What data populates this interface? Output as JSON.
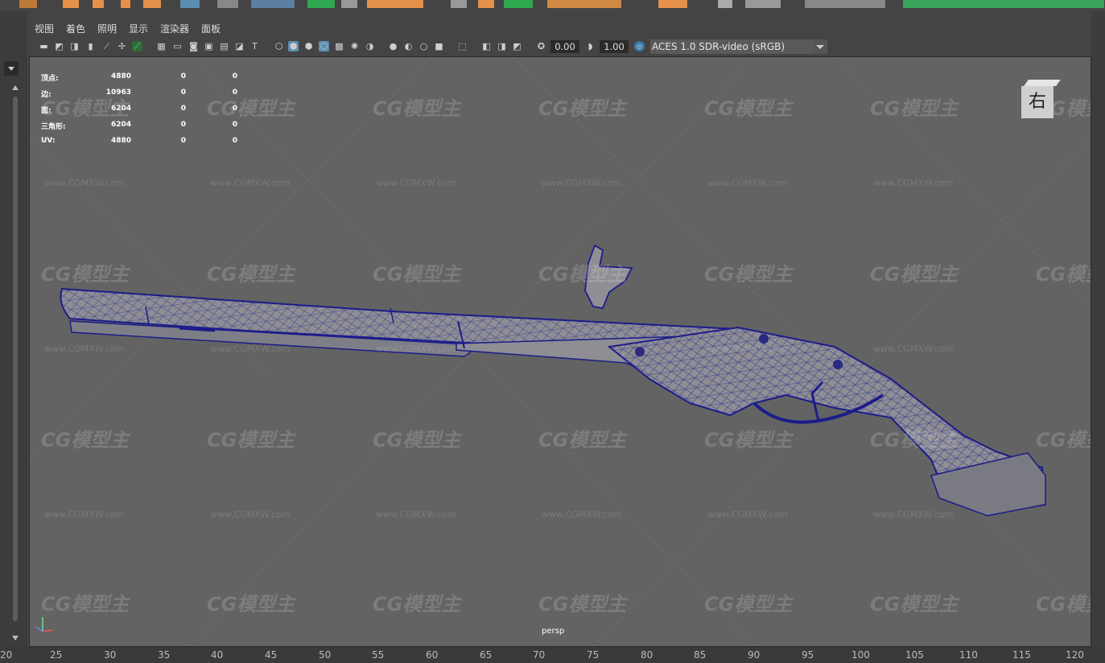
{
  "menus": [
    "视图",
    "着色",
    "照明",
    "显示",
    "渲染器",
    "面板"
  ],
  "panel_toolbar": {
    "field1_value": "0.00",
    "field2_value": "1.00",
    "color_space": "ACES 1.0 SDR-video (sRGB)",
    "colors": {
      "selected_icon": "#5b8fb0",
      "accent_orange": "#e5914a",
      "accent_green": "#2fa84f"
    }
  },
  "hud": {
    "rows": [
      {
        "label": "顶点:",
        "value": "4880",
        "sel1": "0",
        "sel2": "0"
      },
      {
        "label": "边:",
        "value": "10963",
        "sel1": "0",
        "sel2": "0"
      },
      {
        "label": "面:",
        "value": "6204",
        "sel1": "0",
        "sel2": "0"
      },
      {
        "label": "三角形:",
        "value": "6204",
        "sel1": "0",
        "sel2": "0"
      },
      {
        "label": "UV:",
        "value": "4880",
        "sel1": "0",
        "sel2": "0"
      }
    ]
  },
  "viewcube_label": "右",
  "camera_label": "persp",
  "watermark": {
    "logo": "CG模型主",
    "url": "www.CGMXW.com"
  },
  "model": {
    "wire_color": "#1c1c8a",
    "shade_color": "#8e8e94"
  },
  "timeline": {
    "ticks": [
      "20",
      "25",
      "30",
      "35",
      "40",
      "45",
      "50",
      "55",
      "60",
      "65",
      "70",
      "75",
      "80",
      "85",
      "90",
      "95",
      "100",
      "105",
      "110",
      "115",
      "120"
    ]
  }
}
